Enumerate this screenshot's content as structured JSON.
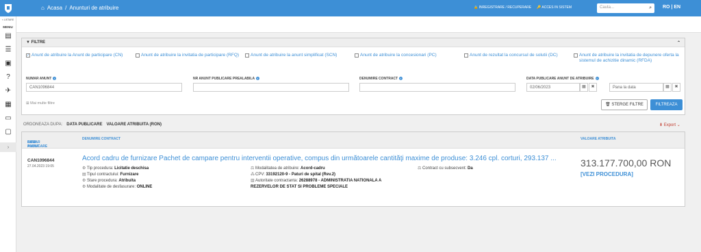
{
  "header": {
    "breadcrumb_home": "Acasa",
    "breadcrumb_sep": "/",
    "breadcrumb_current": "Anunturi de atribuire",
    "register": "INREGISTRARE / RECUPERARE",
    "login": "ACCES IN SISTEM",
    "search_placeholder": "Cauta...",
    "lang": "RO | EN"
  },
  "sidebar": {
    "lst_label": "< LISTARE",
    "menu_label": "MENIU"
  },
  "filters": {
    "title": "FILTRE",
    "checks": [
      {
        "label": "Anunt de atribuire la Anunt de participare (CN)",
        "checked": true
      },
      {
        "label": "Anunt de atribuire la invitatia de participare (RFQ)",
        "checked": false
      },
      {
        "label": "Anunt de atribuire la anunt simplificat (SCN)",
        "checked": false
      },
      {
        "label": "Anunt de atribuire la concesionari (PC)",
        "checked": false
      },
      {
        "label": "Anunt de rezultat la concursul de solutii (DC)",
        "checked": false
      },
      {
        "label": "Anunt de atribuire la invitatia de depunere oferta la sistemul de achizitie dinamic (RFDA)",
        "checked": false
      }
    ],
    "numar_label": "NUMAR ANUNT",
    "numar_value": "CAN1096844",
    "nr_prealabil_label": "NR ANUNT PUBLICARE PREALABILA",
    "denumire_label": "DENUMIRE CONTRACT",
    "data_label": "DATA PUBLICARE ANUNT DE ATRIBUIRE",
    "data_from": "02/06/2023",
    "data_to_placeholder": "Pana la data",
    "more": "Mai multe filtre",
    "clear": "STERGE FILTRE",
    "apply": "FILTREAZA"
  },
  "sort": {
    "label": "ORDONEAZA DUPA:",
    "opt1": "DATA PUBLICARE",
    "opt2": "VALOARE ATRIBUITA (RON)",
    "export": "Export"
  },
  "results": {
    "col1a": "NUMAR ANUNT",
    "col1b": "DATA PUBLICARE",
    "col2": "DENUMIRE CONTRACT",
    "col3": "VALOARE ATRIBUITA",
    "items": [
      {
        "number": "CAN1096844",
        "date": "27.04.2023 19:05",
        "title": "Acord cadru de furnizare Pachet de campare pentru interventii operative, compus din următoarele cantităţi maxime de produse: 3.246 cpl. corturi, 293.137 ...",
        "tip_proc_l": "Tip procedura:",
        "tip_proc_v": "Licitatie deschisa",
        "tip_contr_l": "Tipul contractului:",
        "tip_contr_v": "Furnizare",
        "stare_l": "Stare procedura:",
        "stare_v": "Atribuita",
        "mod_desf_l": "Modalitate de desfasurare:",
        "mod_desf_v": "ONLINE",
        "mod_atr_l": "Modalitatea de atribuire:",
        "mod_atr_v": "Acord-cadru",
        "cpv_l": "CPV:",
        "cpv_v": "33192120-9 - Paturi de spital (Rev.2)",
        "aut_l": "Autoritate contractanta:",
        "aut_v": "26288978 - ADMINISTRATIA NATIONALA A",
        "aut_v2": "REZERVELOR DE STAT SI PROBLEME SPECIALE",
        "subs_l": "Contract cu subsecvent:",
        "subs_v": "Da",
        "value": "313.177.700,00  RON",
        "link": "[VEZI PROCEDURA]"
      }
    ]
  }
}
